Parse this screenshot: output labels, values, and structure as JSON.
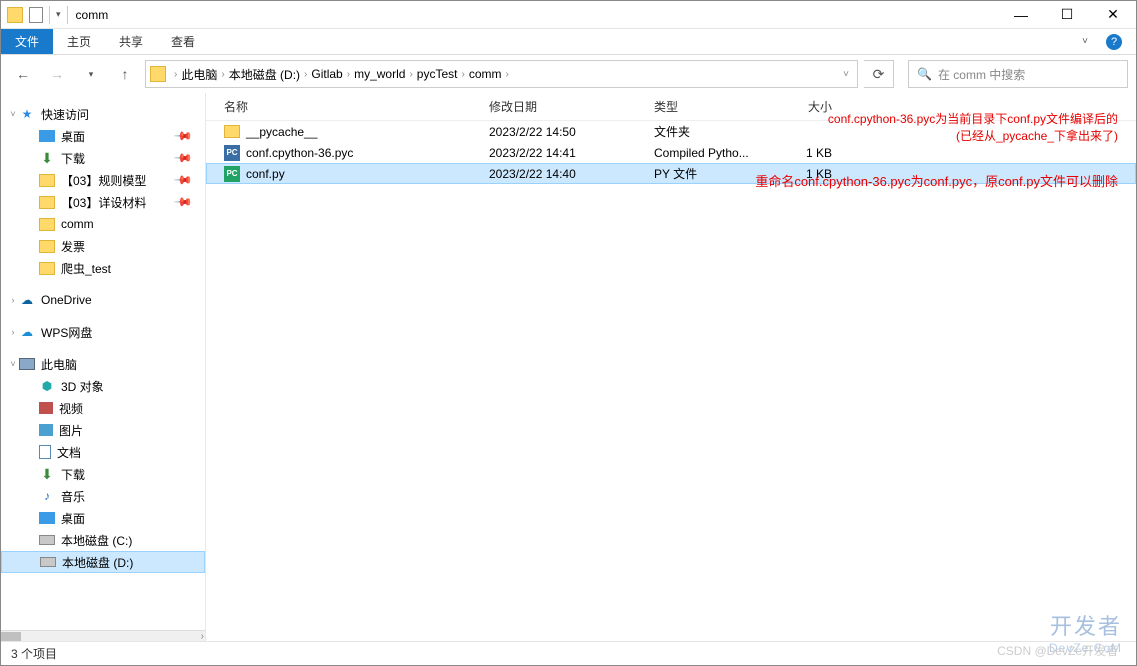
{
  "window": {
    "title": "comm"
  },
  "ribbon": {
    "file": "文件",
    "home": "主页",
    "share": "共享",
    "view": "查看"
  },
  "nav": {
    "crumbs": [
      "此电脑",
      "本地磁盘 (D:)",
      "Gitlab",
      "my_world",
      "pycTest",
      "comm"
    ],
    "search_placeholder": "在 comm 中搜索"
  },
  "sidebar": {
    "quick": {
      "label": "快速访问",
      "items": [
        "桌面",
        "下载",
        "【03】规则模型",
        "【03】详设材料",
        "comm",
        "发票",
        "爬虫_test"
      ]
    },
    "onedrive": "OneDrive",
    "wps": "WPS网盘",
    "thispc": {
      "label": "此电脑",
      "items": [
        "3D 对象",
        "视频",
        "图片",
        "文档",
        "下载",
        "音乐",
        "桌面",
        "本地磁盘 (C:)",
        "本地磁盘 (D:)"
      ]
    }
  },
  "columns": {
    "name": "名称",
    "date": "修改日期",
    "type": "类型",
    "size": "大小"
  },
  "files": [
    {
      "name": "__pycache__",
      "date": "2023/2/22 14:50",
      "type": "文件夹",
      "size": ""
    },
    {
      "name": "conf.cpython-36.pyc",
      "date": "2023/2/22 14:41",
      "type": "Compiled Pytho...",
      "size": "1 KB"
    },
    {
      "name": "conf.py",
      "date": "2023/2/22 14:40",
      "type": "PY 文件",
      "size": "1 KB"
    }
  ],
  "annotations": {
    "a1_l1": "conf.cpython-36.pyc为当前目录下conf.py文件编译后的",
    "a1_l2": "(已经从_pycache_下拿出来了)",
    "a2": "重命名conf.cpython-36.pyc为conf.pyc，原conf.py文件可以删除"
  },
  "status": {
    "count": "3 个项目"
  },
  "watermark": {
    "big": "开发者",
    "site": "DevZe.CoM",
    "csdn": "CSDN @DevZe开发者"
  }
}
